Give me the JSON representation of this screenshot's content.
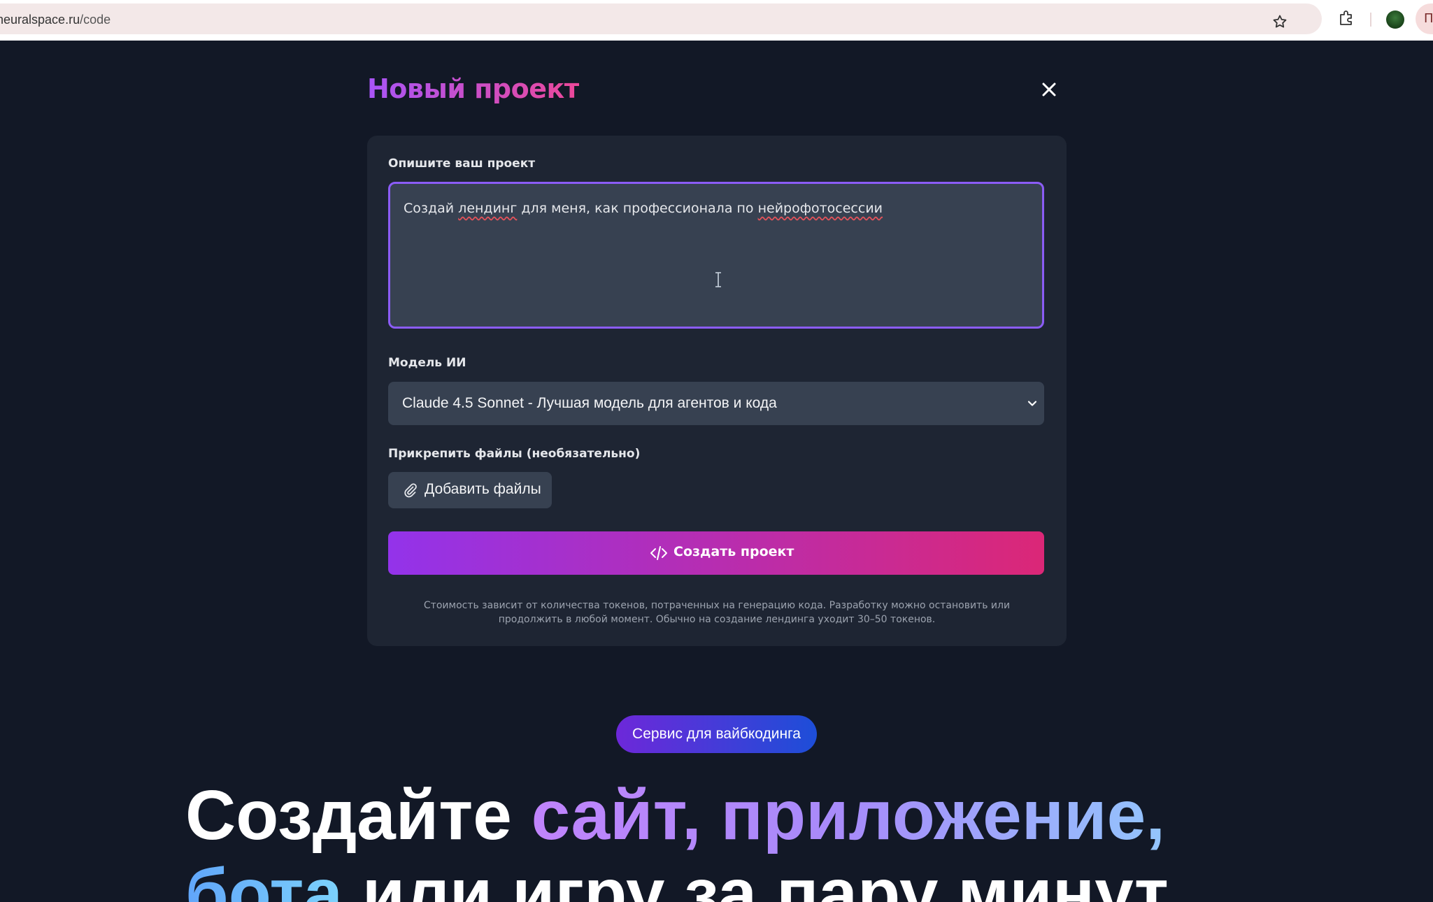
{
  "browser": {
    "url_host": "neuralspace.ru",
    "url_path": "/code",
    "profile_letter": "П"
  },
  "modal": {
    "title": "Новый проект",
    "description_label": "Опишите ваш проект",
    "description_value_parts": [
      "Создай ",
      "лендинг",
      " для меня, как профессионала по ",
      "нейрофотосессии"
    ],
    "model_label": "Модель ИИ",
    "model_selected": "Claude 4.5 Sonnet - Лучшая модель для агентов и кода",
    "attach_label": "Прикрепить файлы (необязательно)",
    "add_files_label": "Добавить файлы",
    "create_label": "Создать проект",
    "disclaimer": "Стоимость зависит от количества токенов, потраченных на генерацию кода. Разработку можно остановить или продолжить в любой момент. Обычно на создание лендинга уходит 30–50 токенов."
  },
  "hero": {
    "badge": "Сервис для вайбкодинга",
    "line1_plain": "Создайте ",
    "line1_accent": "сайт, приложение,",
    "line2_accent": "бота",
    "line2_plain": " или игру за пару минут"
  },
  "colors": {
    "page_bg": "#121826",
    "card_bg": "#1e2533",
    "field_bg": "#374151",
    "focus_border": "#8b5cf6",
    "gradient_start": "#9333ea",
    "gradient_end": "#db2777"
  },
  "icons": {
    "site": "site-info-icon",
    "star": "star-icon",
    "extensions": "extensions-icon",
    "close": "close-icon",
    "dropdown": "chevron-down-icon",
    "attach": "paperclip-icon",
    "code": "code-icon",
    "text_cursor": "text-cursor-icon"
  }
}
